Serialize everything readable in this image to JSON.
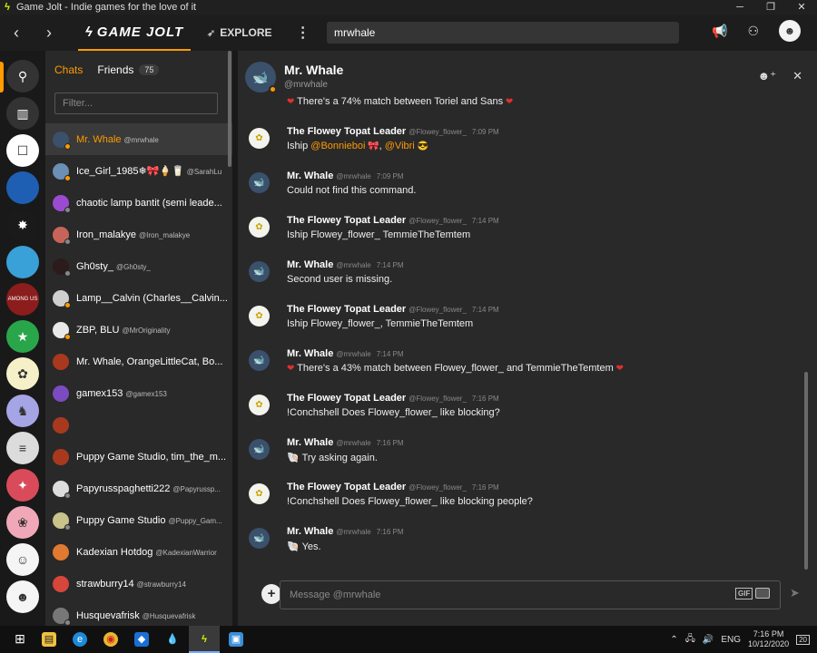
{
  "window": {
    "title": "Game Jolt - Indie games for the love of it",
    "minimize": "─",
    "restore": "❐",
    "close": "✕"
  },
  "topbar": {
    "logo": "GAME JOLT",
    "explore": "EXPLORE",
    "search_value": "mrwhale"
  },
  "chats": {
    "tab_chats": "Chats",
    "tab_friends": "Friends",
    "friends_count": "75",
    "filter_placeholder": "Filter...",
    "items": [
      {
        "name": "Mr. Whale",
        "handle": "@mrwhale",
        "avatar_color": "#3a506b",
        "status_color": "#ff9a00"
      },
      {
        "name": "Ice_Girl_1985❄🎀🍦🥛",
        "handle": "@SarahLu",
        "avatar_color": "#6b8fb5",
        "status_color": "#ff9a00"
      },
      {
        "name": "chaotic lamp bantit (semi leade...",
        "handle": "",
        "avatar_color": "#9b4bd1",
        "status_color": "#888888"
      },
      {
        "name": "Iron_malakye",
        "handle": "@Iron_malakye",
        "avatar_color": "#c7645a",
        "status_color": "#888888"
      },
      {
        "name": "Gh0sty_",
        "handle": "@Gh0sty_",
        "avatar_color": "#2b1b1b",
        "status_color": "#888888"
      },
      {
        "name": "Lamp__Calvin (Charles__Calvin...",
        "handle": "",
        "avatar_color": "#cfcfcf",
        "status_color": "#ff9a00"
      },
      {
        "name": "ZBP, BLU",
        "handle": "@MrOriginality",
        "avatar_color": "#e8e8e8",
        "status_color": "#ff9a00"
      },
      {
        "name": "Mr. Whale, OrangeLittleCat, Bo...",
        "handle": "",
        "avatar_color": "#a8391f",
        "status_color": ""
      },
      {
        "name": "gamex153",
        "handle": "@gamex153",
        "avatar_color": "#7b4bc0",
        "status_color": ""
      },
      {
        "name": "",
        "handle": "",
        "avatar_color": "#a8391f",
        "status_color": ""
      },
      {
        "name": "Puppy Game Studio, tim_the_m...",
        "handle": "",
        "avatar_color": "#a8391f",
        "status_color": ""
      },
      {
        "name": "Papyrusspaghetti222",
        "handle": "@Papyrussp...",
        "avatar_color": "#dddddd",
        "status_color": "#888888"
      },
      {
        "name": "Puppy Game Studio",
        "handle": "@Puppy_Gam...",
        "avatar_color": "#c9c28a",
        "status_color": "#888888"
      },
      {
        "name": "Kadexian Hotdog",
        "handle": "@KadexianWarrior",
        "avatar_color": "#e07a30",
        "status_color": ""
      },
      {
        "name": "strawburry14",
        "handle": "@strawburry14",
        "avatar_color": "#d6463b",
        "status_color": ""
      },
      {
        "name": "Husquevafrisk",
        "handle": "@Husquevafrisk",
        "avatar_color": "#777777",
        "status_color": "#888888"
      }
    ]
  },
  "rail": {
    "items": [
      {
        "icon": "⚲",
        "color": "#333333"
      },
      {
        "icon": "▥",
        "color": "#333333"
      },
      {
        "icon": "☐",
        "color": "#ffffff"
      },
      {
        "icon": "",
        "color": "#1e5fb3"
      },
      {
        "icon": "✸",
        "color": "#1a1a1a"
      },
      {
        "icon": "",
        "color": "#3aa0d8"
      },
      {
        "icon": "AMONG US",
        "color": "#8b1d1d"
      },
      {
        "icon": "★",
        "color": "#2aa64a"
      },
      {
        "icon": "✿",
        "color": "#f5f0c8"
      },
      {
        "icon": "♞",
        "color": "#a5a5e5"
      },
      {
        "icon": "≡",
        "color": "#dcdcdc"
      },
      {
        "icon": "✦",
        "color": "#d94b5a"
      },
      {
        "icon": "❀",
        "color": "#f0a8b8"
      },
      {
        "icon": "☺",
        "color": "#f5f5f5"
      },
      {
        "icon": "☻",
        "color": "#f5f5f5"
      }
    ]
  },
  "conversation": {
    "name": "Mr. Whale",
    "handle": "@mrwhale",
    "messages": [
      {
        "kind": "text",
        "text": "There's a 74% match between Toriel and Sans",
        "heart": true
      },
      {
        "kind": "head",
        "author": "The Flowey Topat Leader",
        "handle": "@Flowey_flower_",
        "time": "7:09 PM",
        "avatar": "flowey"
      },
      {
        "kind": "ship",
        "prefix": "Iship ",
        "mention1": "@Bonnieboi",
        "mid": ", ",
        "mention2": "@Vibri"
      },
      {
        "kind": "head",
        "author": "Mr. Whale",
        "handle": "@mrwhale",
        "time": "7:09 PM",
        "avatar": "whale"
      },
      {
        "kind": "text",
        "text": "Could not find this command."
      },
      {
        "kind": "head",
        "author": "The Flowey Topat Leader",
        "handle": "@Flowey_flower_",
        "time": "7:14 PM",
        "avatar": "flowey"
      },
      {
        "kind": "text",
        "text": "Iship Flowey_flower_ TemmieTheTemtem"
      },
      {
        "kind": "head",
        "author": "Mr. Whale",
        "handle": "@mrwhale",
        "time": "7:14 PM",
        "avatar": "whale"
      },
      {
        "kind": "text",
        "text": "Second user is missing."
      },
      {
        "kind": "head",
        "author": "The Flowey Topat Leader",
        "handle": "@Flowey_flower_",
        "time": "7:14 PM",
        "avatar": "flowey"
      },
      {
        "kind": "text",
        "text": "Iship Flowey_flower_, TemmieTheTemtem"
      },
      {
        "kind": "head",
        "author": "Mr. Whale",
        "handle": "@mrwhale",
        "time": "7:14 PM",
        "avatar": "whale"
      },
      {
        "kind": "text",
        "text": "There's a 43% match between Flowey_flower_ and TemmieTheTemtem",
        "heart": true
      },
      {
        "kind": "head",
        "author": "The Flowey Topat Leader",
        "handle": "@Flowey_flower_",
        "time": "7:16 PM",
        "avatar": "flowey"
      },
      {
        "kind": "text",
        "text": "!Conchshell Does Flowey_flower_ like blocking?"
      },
      {
        "kind": "head",
        "author": "Mr. Whale",
        "handle": "@mrwhale",
        "time": "7:16 PM",
        "avatar": "whale"
      },
      {
        "kind": "text",
        "text": "Try asking again.",
        "shell": true
      },
      {
        "kind": "head",
        "author": "The Flowey Topat Leader",
        "handle": "@Flowey_flower_",
        "time": "7:16 PM",
        "avatar": "flowey"
      },
      {
        "kind": "text",
        "text": "!Conchshell Does Flowey_flower_ like blocking people?"
      },
      {
        "kind": "head",
        "author": "Mr. Whale",
        "handle": "@mrwhale",
        "time": "7:16 PM",
        "avatar": "whale"
      },
      {
        "kind": "text",
        "text": "Yes.",
        "shell": true
      }
    ]
  },
  "composer": {
    "placeholder": "Message @mrwhale",
    "gif": "GIF"
  },
  "taskbar": {
    "lang": "ENG",
    "time": "7:16 PM",
    "date": "10/12/2020",
    "notifications": "20"
  },
  "colors": {
    "accent": "#ff9a00",
    "background": "#292929",
    "heart": "#e03030"
  }
}
